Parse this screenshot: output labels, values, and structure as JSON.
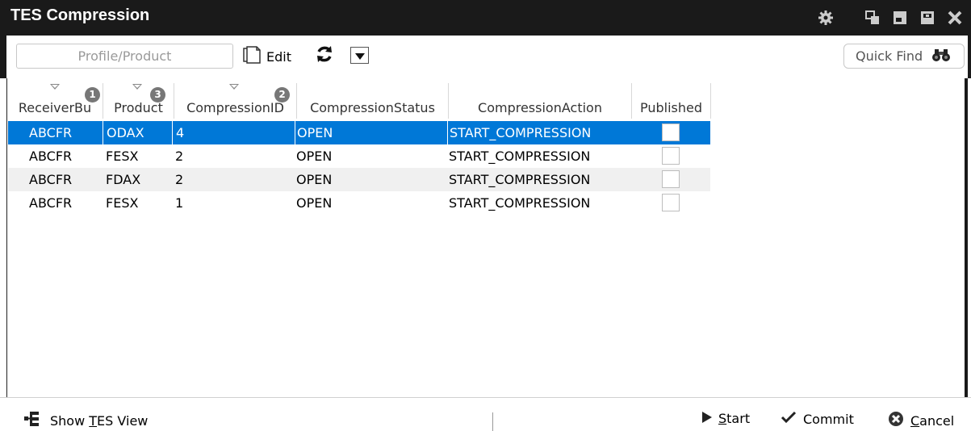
{
  "window": {
    "title": "TES Compression"
  },
  "titlebar_icons": [
    "gear-icon",
    "restore-icon",
    "minimize-icon",
    "maximize-icon",
    "close-icon"
  ],
  "toolbar": {
    "profile_placeholder": "Profile/Product",
    "edit_label": "Edit",
    "quick_find_placeholder": "Quick Find"
  },
  "grid": {
    "columns": [
      {
        "label": "ReceiverBu",
        "badge": "1"
      },
      {
        "label": "Product",
        "badge": "3"
      },
      {
        "label": "CompressionID",
        "badge": "2"
      },
      {
        "label": "CompressionStatus",
        "badge": ""
      },
      {
        "label": "CompressionAction",
        "badge": ""
      },
      {
        "label": "Published",
        "badge": ""
      }
    ],
    "rows": [
      {
        "receiver": "ABCFR",
        "product": "ODAX",
        "id": "4",
        "status": "OPEN",
        "action": "START_COMPRESSION",
        "published": false,
        "selected": true
      },
      {
        "receiver": "ABCFR",
        "product": "FESX",
        "id": "2",
        "status": "OPEN",
        "action": "START_COMPRESSION",
        "published": false,
        "selected": false
      },
      {
        "receiver": "ABCFR",
        "product": "FDAX",
        "id": "2",
        "status": "OPEN",
        "action": "START_COMPRESSION",
        "published": false,
        "selected": false
      },
      {
        "receiver": "ABCFR",
        "product": "FESX",
        "id": "1",
        "status": "OPEN",
        "action": "START_COMPRESSION",
        "published": false,
        "selected": false
      }
    ]
  },
  "footer": {
    "show_tes_pre": "Show ",
    "show_tes_u": "T",
    "show_tes_post": "ES View",
    "start_u": "S",
    "start_rest": "tart",
    "commit_label": "Commit",
    "cancel_u": "C",
    "cancel_rest": "ancel"
  },
  "colors": {
    "titlebar": "#1a1a1a",
    "selection": "#0078d7"
  }
}
